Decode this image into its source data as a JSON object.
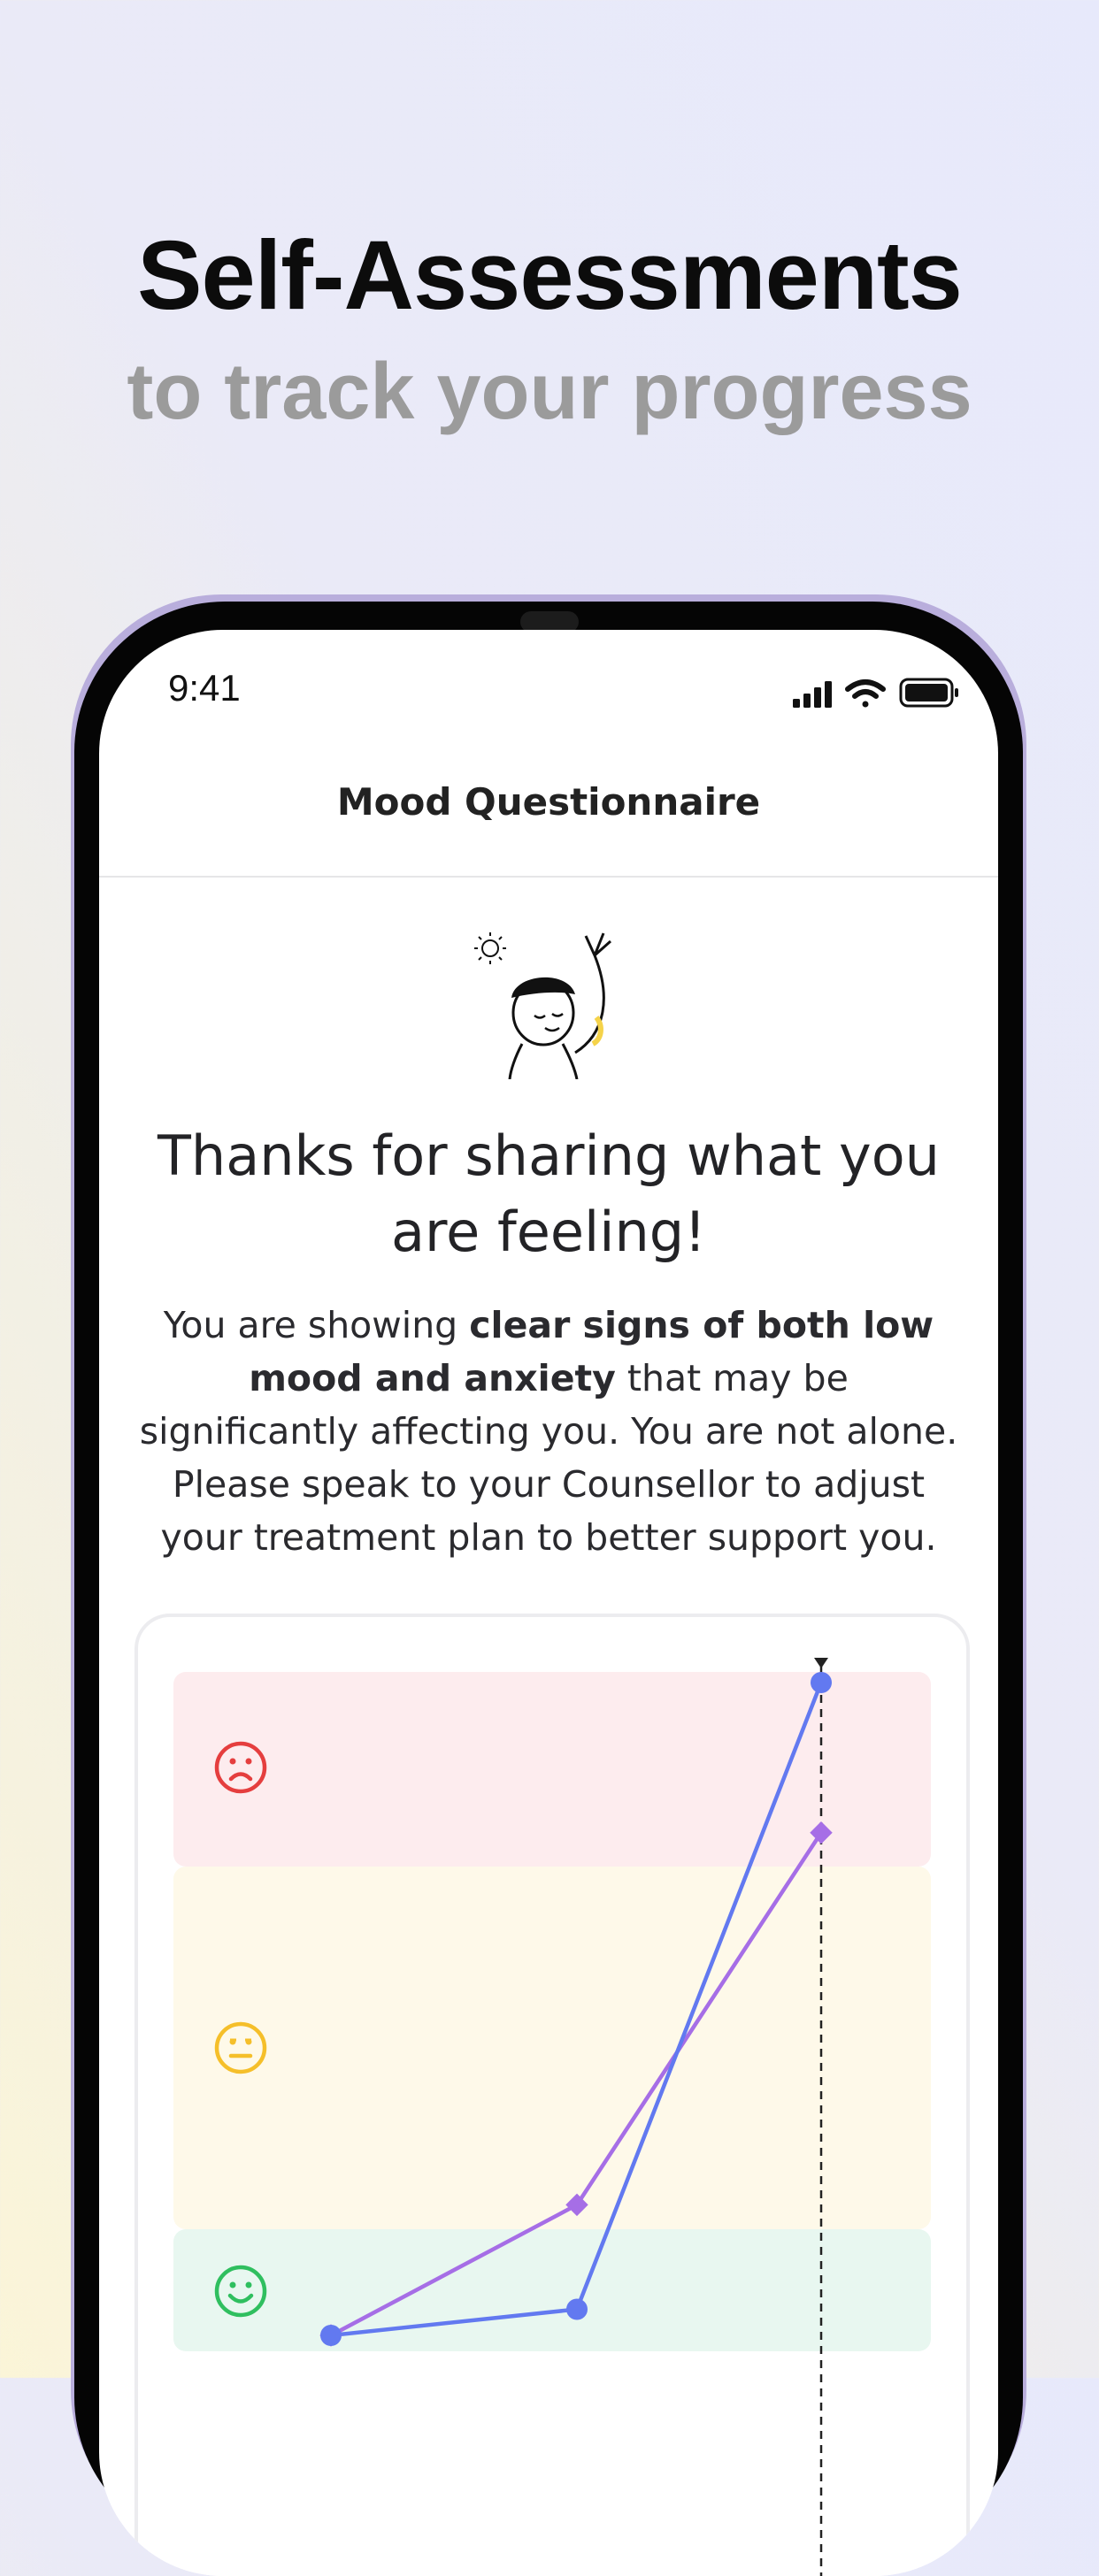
{
  "hero": {
    "title": "Self-Assessments",
    "subtitle": "to track your progress"
  },
  "status_bar": {
    "time": "9:41",
    "icons": [
      "cellular-signal-icon",
      "wifi-icon",
      "battery-icon"
    ]
  },
  "nav": {
    "title": "Mood Questionnaire"
  },
  "illustration": {
    "icon": "waving-person-with-sun-icon"
  },
  "result": {
    "title": "Thanks for sharing what you are feeling!",
    "body_pre": "You are showing ",
    "body_bold": "clear signs of both low mood and anxiety",
    "body_post": " that may be significantly affecting you. You are not alone. Please speak to your Counsellor to adjust your treatment plan to better support you."
  },
  "colors": {
    "zone_bad": "#fdecee",
    "zone_mid": "#fef9e9",
    "zone_good": "#e8f7f0",
    "face_sad": "#e53e3e",
    "face_neutral": "#f5bf2a",
    "face_happy": "#2fbf5f",
    "series_1": "#6279f0",
    "series_2": "#a66ee6"
  },
  "chart_data": {
    "type": "line",
    "x": [
      1,
      2,
      3
    ],
    "ylim": [
      0,
      1
    ],
    "zones": [
      {
        "icon": "sad-face-icon",
        "level": "high"
      },
      {
        "icon": "neutral-face-icon",
        "level": "medium"
      },
      {
        "icon": "happy-face-icon",
        "level": "low"
      }
    ],
    "series": [
      {
        "marker": "circle",
        "values": [
          0.0,
          0.04,
          1.0
        ]
      },
      {
        "marker": "diamond",
        "values": [
          0.0,
          0.2,
          0.77
        ]
      }
    ],
    "current_marker_x": 3
  }
}
